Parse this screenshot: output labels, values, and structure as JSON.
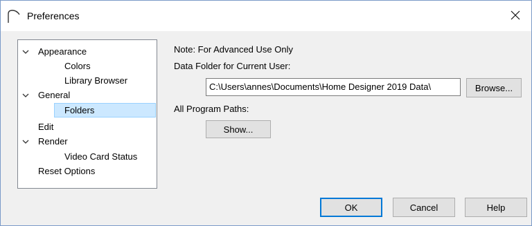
{
  "window": {
    "title": "Preferences",
    "close_glyph": "✕"
  },
  "tree": {
    "items": [
      {
        "label": "Appearance",
        "expanded": true,
        "level": 0
      },
      {
        "label": "Colors",
        "level": 1
      },
      {
        "label": "Library Browser",
        "level": 1
      },
      {
        "label": "General",
        "expanded": true,
        "level": 0
      },
      {
        "label": "Folders",
        "level": 1,
        "selected": true
      },
      {
        "label": "Edit",
        "level": 0
      },
      {
        "label": "Render",
        "expanded": true,
        "level": 0
      },
      {
        "label": "Video Card Status",
        "level": 1
      },
      {
        "label": "Reset Options",
        "level": 0
      }
    ]
  },
  "panel": {
    "note": "Note: For Advanced Use Only",
    "data_folder_label": "Data Folder for Current User:",
    "data_folder_value": "C:\\Users\\annes\\Documents\\Home Designer 2019 Data\\",
    "browse_label": "Browse...",
    "all_paths_label": "All Program Paths:",
    "show_label": "Show..."
  },
  "footer": {
    "ok_label": "OK",
    "cancel_label": "Cancel",
    "help_label": "Help"
  },
  "colors": {
    "selection_bg": "#cce8ff",
    "selection_border": "#99d1ff",
    "default_button_border": "#0078d7"
  }
}
